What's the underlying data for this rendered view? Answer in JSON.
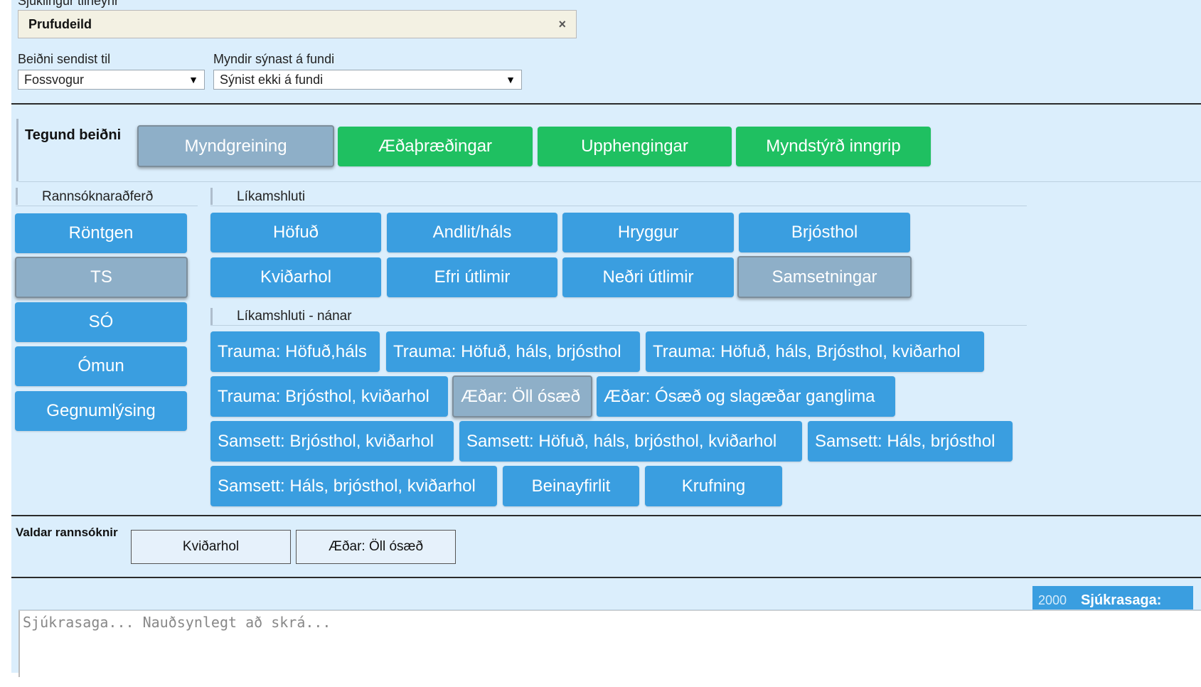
{
  "header": {
    "cut_label": "Sjúklingur tilheyrir",
    "unit_value": "Prufudeild",
    "clear_symbol": "×",
    "send_to": {
      "label": "Beiðni sendist til",
      "value": "Fossvogur"
    },
    "images_meeting": {
      "label": "Myndir sýnast á fundi",
      "value": "Sýnist ekki á fundi"
    },
    "select_arrow": "▼"
  },
  "request_type": {
    "heading": "Tegund beiðni",
    "options": [
      {
        "label": "Myndgreining",
        "state": "selected"
      },
      {
        "label": "Æðaþræðingar",
        "state": "available"
      },
      {
        "label": "Upphengingar",
        "state": "available"
      },
      {
        "label": "Myndstýrð inngrip",
        "state": "available"
      }
    ]
  },
  "method": {
    "heading": "Rannsóknaraðferð",
    "items": [
      "Röntgen",
      "TS",
      "SÓ",
      "Ómun",
      "Gegnumlýsing"
    ],
    "selected": "TS"
  },
  "body_part": {
    "heading": "Líkamshluti",
    "items": [
      "Höfuð",
      "Andlit/háls",
      "Hryggur",
      "Brjósthol",
      "Kviðarhol",
      "Efri útlimir",
      "Neðri útlimir",
      "Samsetningar"
    ],
    "selected": "Samsetningar"
  },
  "body_part_detail": {
    "heading": "Líkamshluti - nánar",
    "items": [
      "Trauma: Höfuð,háls",
      "Trauma: Höfuð, háls, brjósthol",
      "Trauma: Höfuð, háls, Brjósthol, kviðarhol",
      "Trauma: Brjósthol, kviðarhol",
      "Æðar: Öll ósæð",
      "Æðar: Ósæð og slagæðar ganglima",
      "Samsett: Brjósthol, kviðarhol",
      "Samsett: Höfuð, háls, brjósthol, kviðarhol",
      "Samsett: Háls, brjósthol",
      "Samsett: Háls, brjósthol, kviðarhol",
      "Beinayfirlit",
      "Krufning"
    ],
    "selected": "Æðar: Öll ósæð"
  },
  "selected_studies": {
    "label": "Valdar rannsóknir",
    "items": [
      "Kviðarhol",
      "Æðar: Öll ósæð"
    ]
  },
  "history": {
    "char_limit": "2000",
    "title": "Sjúkrasaga:",
    "placeholder": "Sjúkrasaga... Nauðsynlegt að skrá..."
  },
  "colors": {
    "panel_bg": "#dbeefc",
    "primary_blue": "#3a9ee0",
    "green": "#1fc061",
    "selected_grey": "#8eafc8"
  }
}
